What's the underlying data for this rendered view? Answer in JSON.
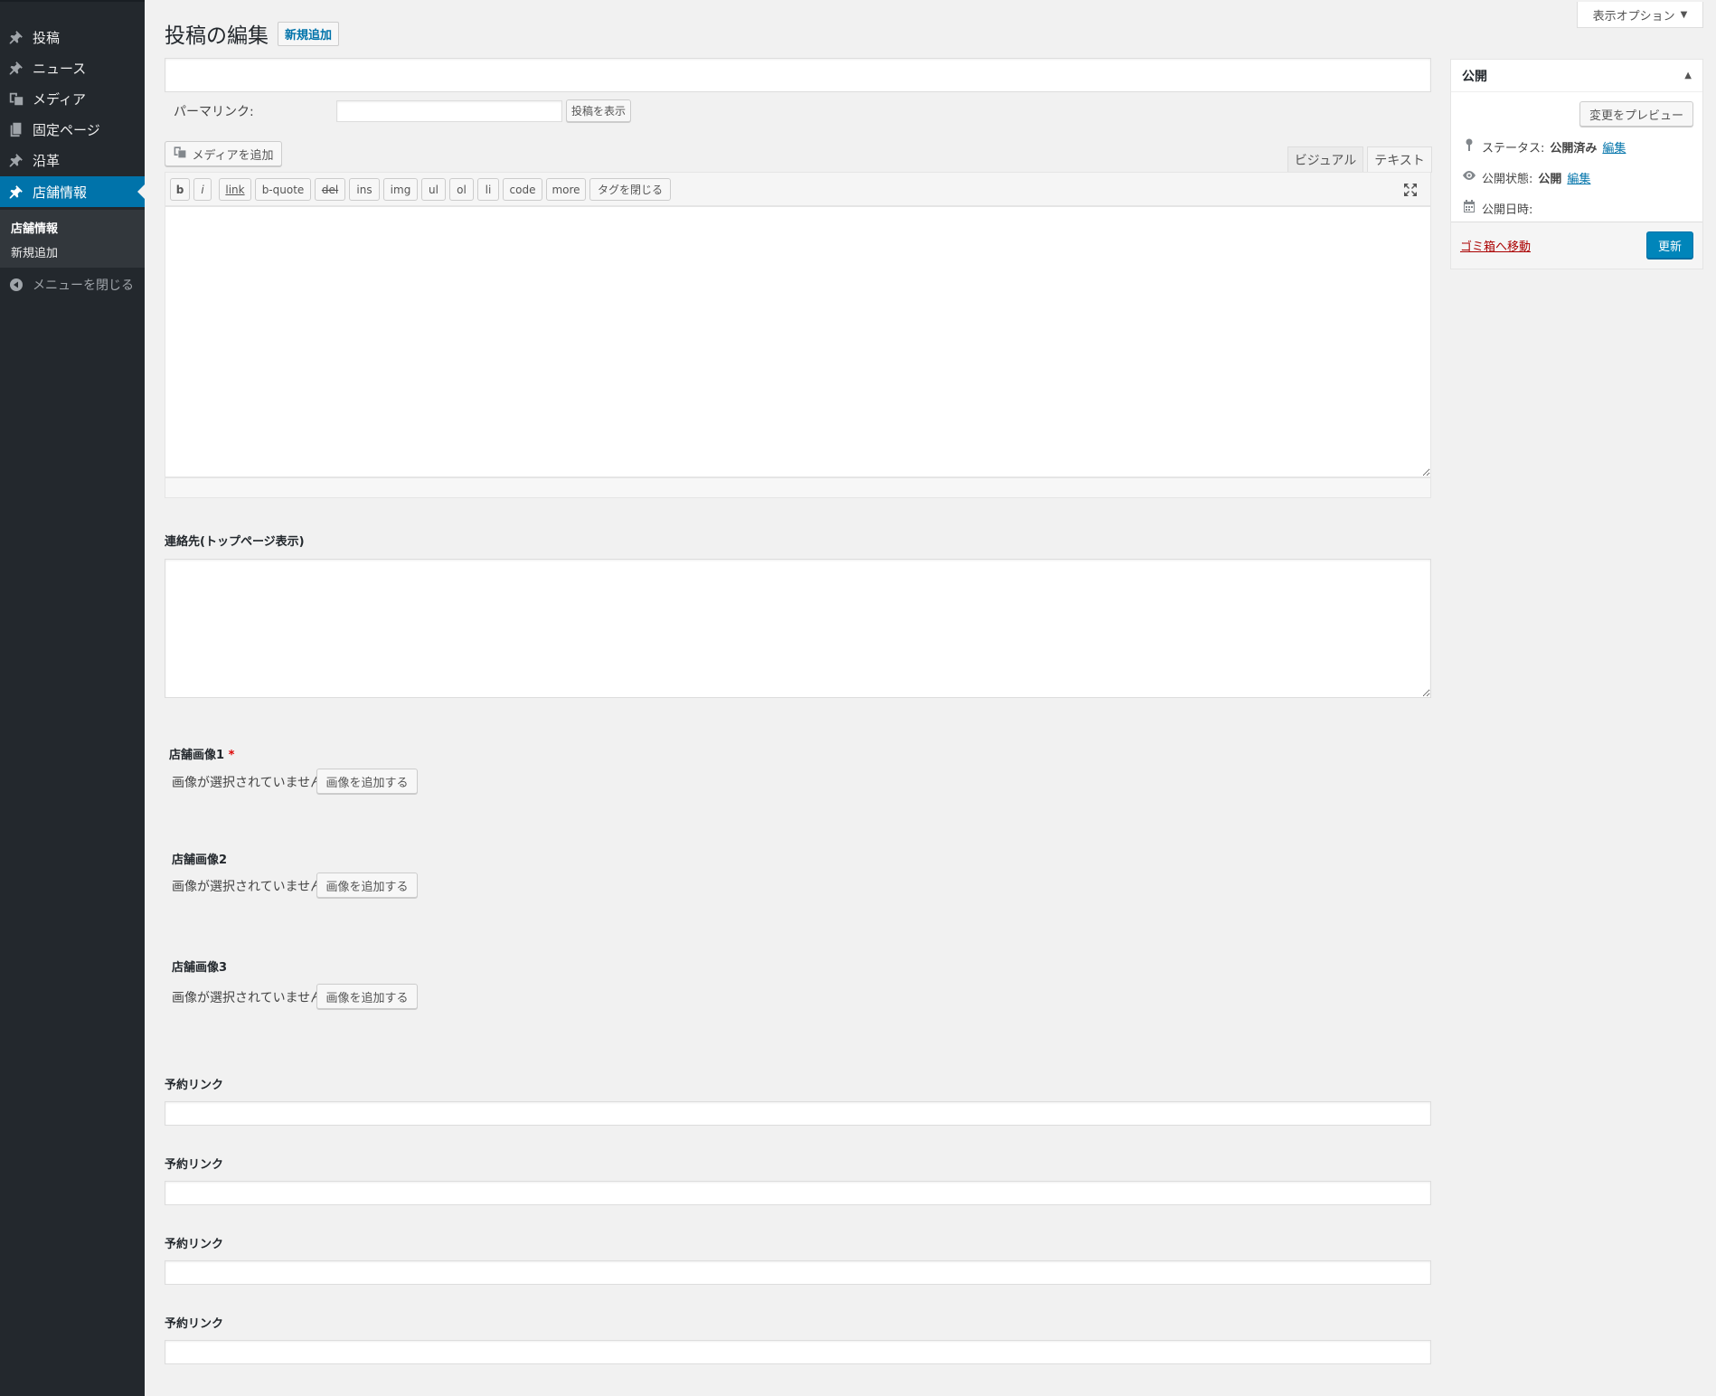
{
  "sidebar": {
    "items": [
      {
        "label": "投稿",
        "icon": "pin-icon"
      },
      {
        "label": "ニュース",
        "icon": "pin-icon"
      },
      {
        "label": "メディア",
        "icon": "media-icon"
      },
      {
        "label": "固定ページ",
        "icon": "page-icon"
      },
      {
        "label": "沿革",
        "icon": "pin-icon"
      },
      {
        "label": "店舗情報",
        "icon": "pin-icon"
      }
    ],
    "submenu": [
      "店舗情報",
      "新規追加"
    ],
    "collapse_label": "メニューを閉じる"
  },
  "screen_options_label": "表示オプション",
  "heading": {
    "title": "投稿の編集",
    "add_new": "新規追加"
  },
  "title_field": {
    "value": ""
  },
  "permalink": {
    "label": "パーマリンク:",
    "value": "",
    "view_button": "投稿を表示"
  },
  "editor": {
    "add_media": "メディアを追加",
    "tabs": [
      "ビジュアル",
      "テキスト"
    ],
    "active_tab": "テキスト",
    "quicktags": [
      "b",
      "i",
      "link",
      "b-quote",
      "del",
      "ins",
      "img",
      "ul",
      "ol",
      "li",
      "code",
      "more",
      "タグを閉じる"
    ],
    "content": ""
  },
  "contact": {
    "label": "連絡先(トップページ表示)",
    "value": ""
  },
  "images": [
    {
      "label": "店舗画像1",
      "required_mark": "*",
      "status": "画像が選択されていません",
      "button": "画像を追加する"
    },
    {
      "label": "店舗画像2",
      "status": "画像が選択されていません",
      "button": "画像を追加する"
    },
    {
      "label": "店舗画像3",
      "status": "画像が選択されていません",
      "button": "画像を追加する"
    }
  ],
  "reservation_links": [
    {
      "label": "予約リンク",
      "value": ""
    },
    {
      "label": "予約リンク",
      "value": ""
    },
    {
      "label": "予約リンク",
      "value": ""
    },
    {
      "label": "予約リンク",
      "value": ""
    }
  ],
  "publish": {
    "title": "公開",
    "preview_button": "変更をプレビュー",
    "status_label": "ステータス:",
    "status_value": "公開済み",
    "visibility_label": "公開状態:",
    "visibility_value": "公開",
    "edit_link": "編集",
    "date_label": "公開日時:",
    "trash_link": "ゴミ箱へ移動",
    "update_button": "更新"
  },
  "colors": {
    "accent": "#0073aa",
    "sidebar_bg": "#23282d",
    "primary_button": "#0085ba",
    "trash": "#a00000"
  }
}
